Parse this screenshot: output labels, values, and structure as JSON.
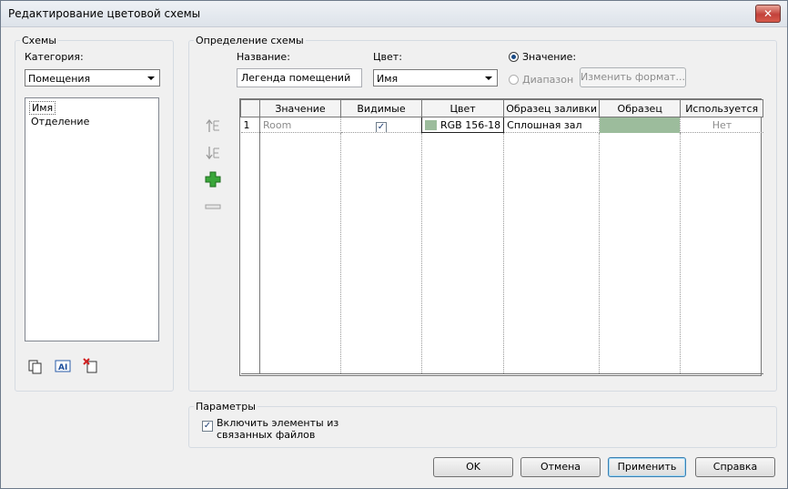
{
  "window": {
    "title": "Редактирование цветовой схемы",
    "close_label": "✕"
  },
  "schemes": {
    "group_title": "Схемы",
    "category_label": "Категория:",
    "category_value": "Помещения",
    "items": [
      "Имя",
      "Отделение"
    ]
  },
  "definition": {
    "group_title": "Определение схемы",
    "name_label": "Название:",
    "name_value": "Легенда помещений",
    "color_label": "Цвет:",
    "color_value": "Имя",
    "radio_value_label": "Значение:",
    "radio_range_label": "Диапазон",
    "change_format_label": "Изменить формат...",
    "columns": [
      "",
      "Значение",
      "Видимые",
      "Цвет",
      "Образец заливки",
      "Образец",
      "Используется"
    ],
    "rows": [
      {
        "num": "1",
        "value": "Room",
        "visible": true,
        "color": "RGB 156-18",
        "fill_pattern": "Сплошная зал",
        "sample_color": "#9cbc9c",
        "used": "Нет"
      }
    ]
  },
  "params": {
    "group_title": "Параметры",
    "include_linked_label_1": "Включить элементы из",
    "include_linked_label_2": "связанных файлов"
  },
  "buttons": {
    "ok": "OK",
    "cancel": "Отмена",
    "apply": "Применить",
    "help": "Справка"
  },
  "colors": {
    "accent": "#3c7fb1",
    "swatch": "#9cbc9c",
    "add_icon": "#3aa63a"
  }
}
